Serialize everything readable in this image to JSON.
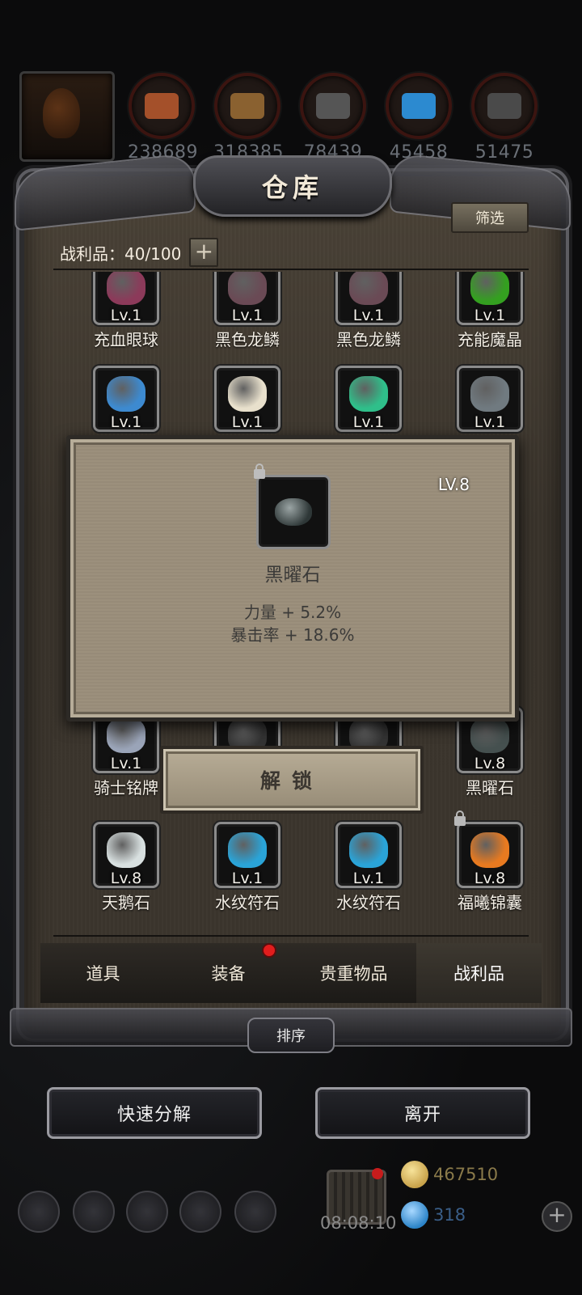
{
  "resources": {
    "items": [
      {
        "icon": "meat-icon",
        "value": "238689",
        "color": "#a4502a"
      },
      {
        "icon": "wood-icon",
        "value": "318385",
        "color": "#8a6130"
      },
      {
        "icon": "iron-icon",
        "value": "78439",
        "color": "#555"
      },
      {
        "icon": "crystal-icon",
        "value": "45458",
        "color": "#2c8ad0"
      },
      {
        "icon": "stone-icon",
        "value": "51475",
        "color": "#4a4a4a"
      }
    ]
  },
  "window": {
    "title": "仓库",
    "filter_label": "筛选",
    "loot_label": "战利品：40/100",
    "add_label": "+"
  },
  "grid": {
    "rows": [
      [
        {
          "name": "充血眼球",
          "level": "Lv.1",
          "color": "#8c3a5a",
          "locked": false
        },
        {
          "name": "黑色龙鳞",
          "level": "Lv.1",
          "color": "#6a4a55",
          "locked": false
        },
        {
          "name": "黑色龙鳞",
          "level": "Lv.1",
          "color": "#6a4a55",
          "locked": false
        },
        {
          "name": "充能魔晶",
          "level": "Lv.1",
          "color": "#34a020",
          "locked": false
        }
      ],
      [
        {
          "name": "",
          "level": "Lv.1",
          "color": "#3d8ad0",
          "locked": false
        },
        {
          "name": "",
          "level": "Lv.1",
          "color": "#e8e0cc",
          "locked": false
        },
        {
          "name": "",
          "level": "Lv.1",
          "color": "#2fbf8a",
          "locked": false
        },
        {
          "name": "",
          "level": "Lv.1",
          "color": "#707a80",
          "locked": false
        }
      ],
      [
        {
          "name": "骑士铭牌",
          "level": "Lv.1",
          "color": "#9aa4b8",
          "locked": false
        },
        {
          "name": "",
          "level": "",
          "color": "#333",
          "locked": false
        },
        {
          "name": "",
          "level": "",
          "color": "#333",
          "locked": false
        },
        {
          "name": "黑曜石",
          "level": "Lv.8",
          "color": "#45504f",
          "locked": true
        }
      ],
      [
        {
          "name": "天鹅石",
          "level": "Lv.8",
          "color": "#d8e0e0",
          "locked": false
        },
        {
          "name": "水纹符石",
          "level": "Lv.1",
          "color": "#2aa4d8",
          "locked": false
        },
        {
          "name": "水纹符石",
          "level": "Lv.1",
          "color": "#2aa4d8",
          "locked": false
        },
        {
          "name": "福曦锦囊",
          "level": "Lv.8",
          "color": "#e87a20",
          "locked": true
        }
      ]
    ]
  },
  "tabs": [
    {
      "label": "道具",
      "active": false,
      "dot": false
    },
    {
      "label": "装备",
      "active": false,
      "dot": true
    },
    {
      "label": "贵重物品",
      "active": false,
      "dot": false
    },
    {
      "label": "战利品",
      "active": true,
      "dot": false
    }
  ],
  "sort_label": "排序",
  "actions": {
    "decompose_label": "快速分解",
    "leave_label": "离开"
  },
  "hud": {
    "timer": "08:08:10",
    "gold": "467510",
    "gold_color": "#c8a24a",
    "gems": "318",
    "gems_color": "#2c84c8",
    "plus_label": "+"
  },
  "popup": {
    "item_name": "黑曜石",
    "level": "LV.8",
    "stats": [
      "力量 + 5.2%",
      "暴击率 + 18.6%"
    ],
    "locked": true
  },
  "unlock_label": "解锁"
}
